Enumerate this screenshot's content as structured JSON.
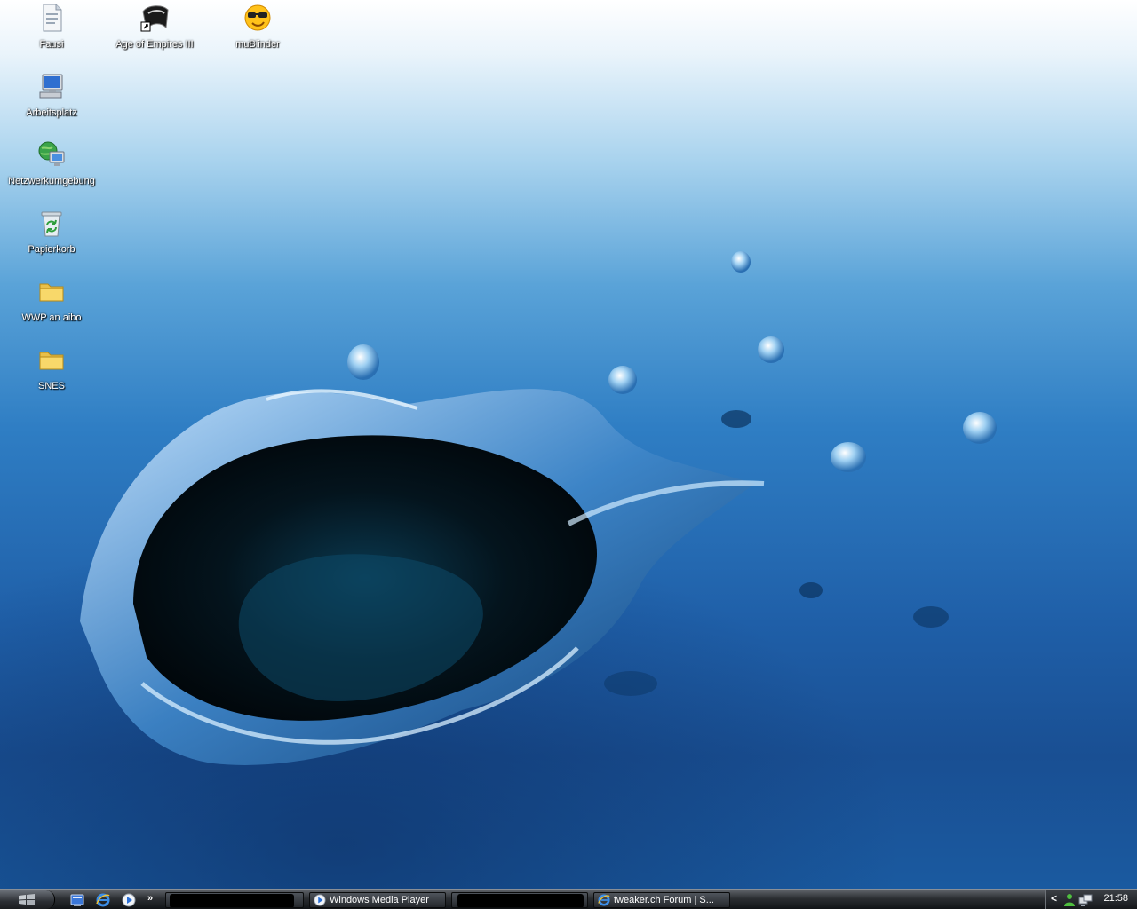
{
  "desktop": {
    "icons": [
      {
        "label": "Fausi",
        "icon": "document-icon"
      },
      {
        "label": "Age of Empires III",
        "icon": "game-shortcut-icon"
      },
      {
        "label": "muBlinder",
        "icon": "smiley-sunglasses-icon"
      },
      {
        "label": "Arbeitsplatz",
        "icon": "my-computer-icon"
      },
      {
        "label": "Netzwerkumgebung",
        "icon": "network-places-icon"
      },
      {
        "label": "Papierkorb",
        "icon": "recycle-bin-icon"
      },
      {
        "label": "WWP an aibo",
        "icon": "folder-icon"
      },
      {
        "label": "SNES",
        "icon": "folder-icon"
      }
    ]
  },
  "taskbar": {
    "quick_launch": [
      "show-desktop-icon",
      "internet-explorer-icon",
      "media-player-icon"
    ],
    "quick_launch_more": "»",
    "tasks": [
      {
        "label": "",
        "redacted": true
      },
      {
        "label": "Windows Media Player",
        "icon": "media-player-icon"
      },
      {
        "label": "",
        "redacted": true
      },
      {
        "label": "tweaker.ch Forum | S...",
        "icon": "internet-explorer-icon"
      }
    ],
    "tray": {
      "expand": "<",
      "icons": [
        "messenger-icon",
        "network-icon"
      ],
      "clock": "21:58"
    }
  },
  "colors": {
    "wallpaper_top": "#ffffff",
    "wallpaper_bottom": "#1a5aa0",
    "taskbar": "#2a2d31"
  }
}
